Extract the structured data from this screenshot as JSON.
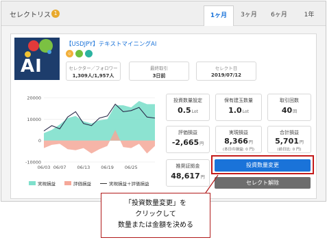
{
  "header": {
    "title": "セレクトリスト",
    "badge": "1"
  },
  "tabs": [
    {
      "label": "1ヶ月",
      "active": true
    },
    {
      "label": "3ヶ月",
      "active": false
    },
    {
      "label": "6ヶ月",
      "active": false
    },
    {
      "label": "1年",
      "active": false
    }
  ],
  "strategy": {
    "logo_text": "AI",
    "name": "【USDJPY】テキストマイニングAI",
    "badges": [
      "person-icon",
      "label-badge-green",
      "label-badge-teal"
    ],
    "stats": [
      {
        "label": "セレクター／フォロワー",
        "value": "1,309人/1,957人"
      },
      {
        "label": "最終取引",
        "value": "3日前"
      },
      {
        "label": "セレクト日",
        "value": "2019/07/12"
      }
    ]
  },
  "metrics": [
    {
      "label": "投資数量設定",
      "value": "0.5",
      "unit": "Lot",
      "sub": ""
    },
    {
      "label": "保有建玉数量",
      "value": "1.0",
      "unit": "Lot",
      "sub": ""
    },
    {
      "label": "取引回数",
      "value": "40",
      "unit": "回",
      "sub": ""
    },
    {
      "label": "評価損益",
      "value": "-2,665",
      "unit": "円",
      "sub": ""
    },
    {
      "label": "実現損益",
      "value": "8,366",
      "unit": "円",
      "sub": "(本日の損益: 0 円)"
    },
    {
      "label": "合計損益",
      "value": "5,701",
      "unit": "円",
      "sub": "(前日比: 0 円)"
    },
    {
      "label": "推奨証拠金",
      "value": "48,617",
      "unit": "円",
      "sub": ""
    }
  ],
  "buttons": {
    "primary": "投資数量変更",
    "secondary": "セレクト解除"
  },
  "callout": {
    "line1": "「投資数量変更」を",
    "line2": "クリックして",
    "line3": "数量または金額を決める"
  },
  "colors": {
    "accent": "#1a73d9",
    "realized": "#7fe0cc",
    "unrealized": "#f5a899",
    "line": "#2b2b4a",
    "highlight_frame": "#c41a1a"
  },
  "chart_data": {
    "type": "area",
    "x": [
      "06/03",
      "06/05",
      "06/07",
      "06/09",
      "06/11",
      "06/13",
      "06/15",
      "06/17",
      "06/19",
      "06/21",
      "06/23",
      "06/25",
      "06/27",
      "06/29",
      "07/01"
    ],
    "xticks": [
      "06/03",
      "06/07",
      "06/13",
      "06/19",
      "06/25"
    ],
    "yticks": [
      20000,
      10000,
      0,
      -10000
    ],
    "ylim": [
      -10000,
      20000
    ],
    "series": [
      {
        "name": "実現損益",
        "type": "area",
        "values": [
          3500,
          5000,
          7500,
          10500,
          11500,
          9000,
          8000,
          9500,
          10000,
          16500,
          16500,
          15500,
          18500,
          17000,
          17000
        ]
      },
      {
        "name": "評価損益",
        "type": "area",
        "values": [
          -3500,
          -2000,
          -1500,
          -4000,
          -4500,
          -3500,
          -6000,
          -4000,
          -2500,
          5000,
          -3000,
          -3500,
          -1500,
          -6000,
          -2500
        ]
      },
      {
        "name": "実現損益＋評価損益",
        "type": "line",
        "values": [
          4500,
          7000,
          5500,
          11000,
          13500,
          8000,
          7000,
          10500,
          11500,
          17000,
          13500,
          14000,
          15500,
          11000,
          10500
        ]
      }
    ]
  }
}
